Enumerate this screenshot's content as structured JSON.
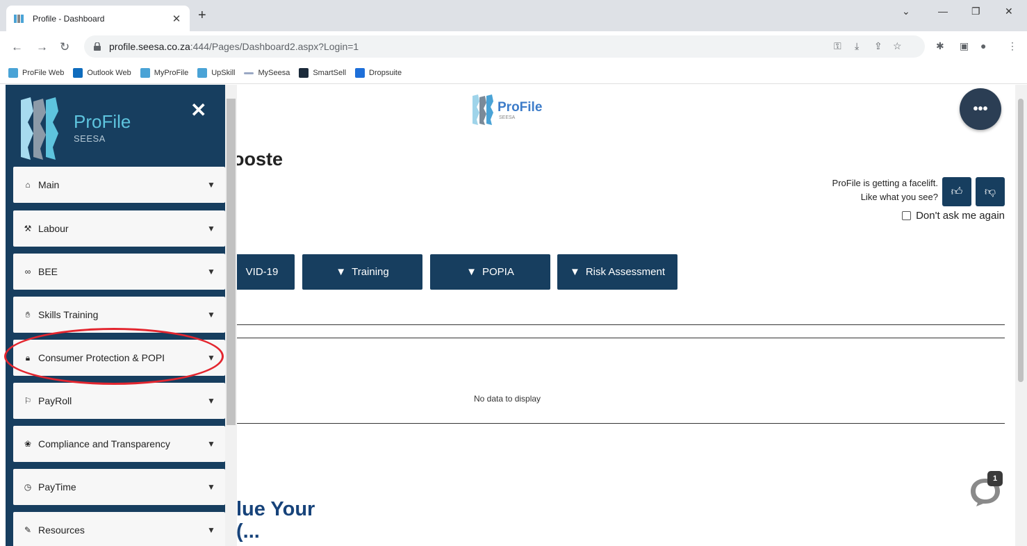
{
  "browser": {
    "tab_title": "Profile - Dashboard",
    "url_host": "profile.seesa.co.za",
    "url_path": ":444/Pages/Dashboard2.aspx?Login=1",
    "bookmarks": [
      {
        "label": "ProFile Web",
        "color": "#4aa3d6"
      },
      {
        "label": "Outlook Web",
        "color": "#0f6cbd"
      },
      {
        "label": "MyProFile",
        "color": "#4aa3d6"
      },
      {
        "label": "UpSkill",
        "color": "#4aa3d6"
      },
      {
        "label": "MySeesa",
        "color": "#9aa8c4"
      },
      {
        "label": "SmartSell",
        "color": "#1b2a3a"
      },
      {
        "label": "Dropsuite",
        "color": "#1e6fd9"
      }
    ]
  },
  "sidebar": {
    "brand_name": "ProFile",
    "brand_sub": "SEESA",
    "items": [
      {
        "label": "Main",
        "icon": "home-icon"
      },
      {
        "label": "Labour",
        "icon": "gavel-icon"
      },
      {
        "label": "BEE",
        "icon": "handshake-icon"
      },
      {
        "label": "Skills Training",
        "icon": "hand-icon"
      },
      {
        "label": "Consumer Protection & POPI",
        "icon": "lock-icon"
      },
      {
        "label": "PayRoll",
        "icon": "flag-icon"
      },
      {
        "label": "Compliance and Transparency",
        "icon": "paw-icon"
      },
      {
        "label": "PayTime",
        "icon": "clock-icon"
      },
      {
        "label": "Resources",
        "icon": "wrench-icon"
      }
    ]
  },
  "main": {
    "logo_name": "ProFile",
    "logo_sub": "SEESA",
    "greeting": "ooste",
    "facelift_line1": "ProFile is getting a facelift.",
    "facelift_line2": "Like what you see?",
    "dont_ask": "Don't ask me again",
    "categories": [
      {
        "label": "VID-19"
      },
      {
        "label": "Training"
      },
      {
        "label": "POPIA"
      },
      {
        "label": "Risk Assessment"
      }
    ],
    "no_data": "No data to display",
    "value_heading_line1": "lue Your",
    "value_heading_line2": "(..."
  },
  "chat": {
    "badge_count": "1"
  },
  "colors": {
    "primary": "#173e5f",
    "accent": "#5ec4de",
    "highlight": "#e3262f"
  }
}
